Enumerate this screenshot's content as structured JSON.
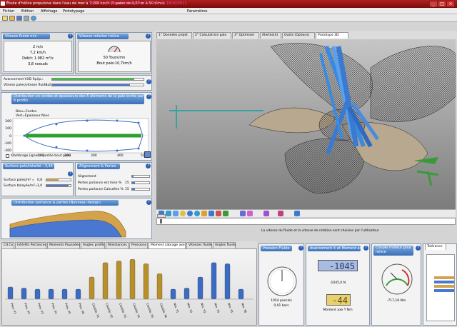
{
  "app": {
    "title": "Étude d'hélice propulsive dans l'eau de mer à 7,200 km/h (5 pales de 0,37 m à 50 t/mn)",
    "update_notice": "mise à jour disponible Version 7.3.2.20 du 18/10/2011"
  },
  "menu": [
    "Fichier",
    "Edition",
    "Affichage",
    "Prototypage",
    "Paramètres"
  ],
  "boat_speed": {
    "title": "Vitesse fluide m/s",
    "values": [
      "2 m/s",
      "7,2 km/h",
      "Débit: 1.982 m³/s",
      "3,8 noeuds"
    ]
  },
  "rotation": {
    "title": "Vitesse rotation hélice",
    "rpm": "50 Tours/mn",
    "tip_speed": "Bout pale:10,7km/h"
  },
  "advance": {
    "label1": "Avancement VXD Rpi/p=",
    "label2": "Vitesse pales/vitesse fluide=",
    "value2": "1,0",
    "bar1_fill": 0.9,
    "bar2_fill": 0.85,
    "bar1_color": "#3fbf3f",
    "bar2_color": "#4a78d0"
  },
  "distribution": {
    "title": "Distribution en cordes et épaisseurs des 5 éléments de la pale écrite par 6 profils",
    "legend1": "Bleu=Cordes",
    "legend2": "Vert=Épaisseur Nsec",
    "y_ticks": [
      "200",
      "100",
      "0",
      "-100",
      "-200"
    ],
    "x_ticks": [
      "0",
      "100",
      "200",
      "300",
      "400",
      "500"
    ],
    "checkbox": "Cambrage (ignorer portée bout pale)"
  },
  "surface": {
    "title": "Surface pale/totalité : 3,34",
    "label1": "Surface pales/m² =",
    "value1": "0,8",
    "label2": "Surface balayée/m²=",
    "value2": "1,0",
    "bar1_fill": 0.5,
    "bar2_fill": 0.9
  },
  "alignment": {
    "title": "Alignement & Pertes",
    "label1": "Alignement",
    "label2": "Pertes parlance est mise %",
    "value2": "15",
    "label3": "Pertes parlance Calculées %",
    "value3": "15",
    "bar1_fill": 0.1,
    "bar2_fill": 0.15,
    "bar3_fill": 0.15
  },
  "pressure_dist": {
    "title": "Distribution portance & pertes (Nouveau design)"
  },
  "tabs_top": [
    "1° Données projet",
    "2° Calculatrice pale",
    "3° Optimiser",
    "Alertes(4)",
    "Outils (Options)",
    "Prototype 3D"
  ],
  "bottom_status": "La vitesse du fluide et la vitesse de rotation sont choisies par l'utilisateur",
  "tabs_bottom": [
    "Cd Cx",
    "Intérêts Portances",
    "Moments Poussées",
    "Angles profils",
    "Résistances",
    "Pressions",
    "Moment cabrage axe Y",
    "Vitesses fluide",
    "Angles fluide"
  ],
  "bar_chart": {
    "labels": [
      "Pres. Y1",
      "Pres. Y2",
      "Pres. Y3",
      "Pres. Y4",
      "Pres. Y5",
      "Pres. Y6",
      "Cisaille. Y1",
      "Cisaille. Y2",
      "Cisaille. Y3",
      "Cisaille. Y4",
      "Cisaille. Y5",
      "Cisaille. Y6",
      "Nm. Y1",
      "Nm. Y2",
      "Nm. Y3",
      "Nm. Y4",
      "Nm. Y5",
      "Nm. Y6"
    ],
    "values": [
      22,
      20,
      18,
      18,
      18,
      18,
      40,
      66,
      69,
      72,
      64,
      46,
      18,
      20,
      40,
      66,
      64,
      18
    ],
    "series_colors": [
      "#3a6cc4",
      "#3a6cc4",
      "#3a6cc4",
      "#3a6cc4",
      "#3a6cc4",
      "#3a6cc4",
      "#b8902a",
      "#b8902a",
      "#b8902a",
      "#b8902a",
      "#b8902a",
      "#b8902a",
      "#3a6cc4",
      "#3a6cc4",
      "#3a6cc4",
      "#3a6cc4",
      "#3a6cc4",
      "#3a6cc4"
    ]
  },
  "fluid_pressure": {
    "title": "Pression Fluide",
    "value1": "1054 pascals",
    "value2": "0,01 bars"
  },
  "moment": {
    "title": "Avancement X et Moment axe Y",
    "lcd1": "-1045",
    "value1": "-1045,0 N",
    "lcd2": "-44",
    "value2": "Moment axe Y Nm"
  },
  "torque": {
    "title": "Couple moteur pour hélice",
    "value": "-717,18 Nm"
  },
  "right_tab": "Tolérance"
}
